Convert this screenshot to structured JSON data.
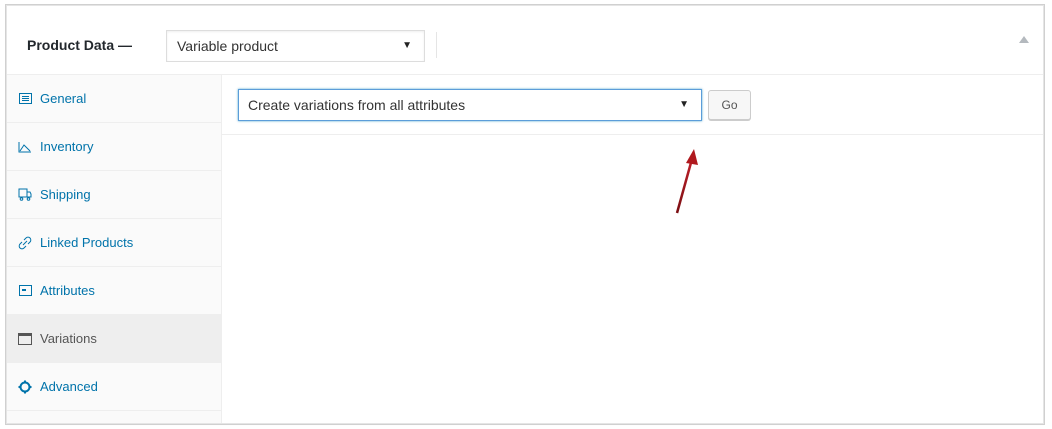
{
  "header": {
    "title": "Product Data —",
    "product_type": "Variable product",
    "collapse_icon": "triangle-up-icon"
  },
  "sidebar": {
    "items": [
      {
        "label": "General",
        "icon": "general-icon",
        "active": false
      },
      {
        "label": "Inventory",
        "icon": "inventory-icon",
        "active": false
      },
      {
        "label": "Shipping",
        "icon": "shipping-icon",
        "active": false
      },
      {
        "label": "Linked Products",
        "icon": "link-icon",
        "active": false
      },
      {
        "label": "Attributes",
        "icon": "attributes-icon",
        "active": false
      },
      {
        "label": "Variations",
        "icon": "variations-icon",
        "active": true
      },
      {
        "label": "Advanced",
        "icon": "gear-icon",
        "active": false
      }
    ]
  },
  "variations": {
    "bulk_action": "Create variations from all attributes",
    "go_label": "Go"
  },
  "colors": {
    "link": "#0073aa",
    "focus_border": "#5b9dd9",
    "annotation_arrow": "#b0191e"
  }
}
